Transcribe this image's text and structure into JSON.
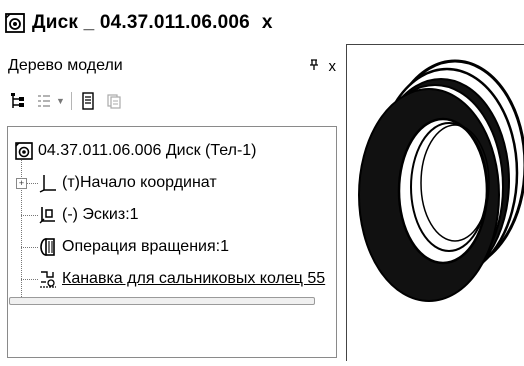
{
  "document_tab": {
    "title": "Диск _ 04.37.011.06.006",
    "close_label": "x"
  },
  "panel": {
    "title": "Дерево модели",
    "pin_label": "ᵃ",
    "close_label": "x"
  },
  "toolbar": {
    "icons": [
      "tree-structure-icon",
      "list-view-icon",
      "dropdown-caret-icon",
      "properties-icon",
      "copy-view-icon"
    ]
  },
  "tree": {
    "items": [
      {
        "label": "04.37.011.06.006 Диск (Тел-1)",
        "icon": "part-icon"
      },
      {
        "label": "(т)Начало координат",
        "icon": "origin-axes-icon",
        "expander": "+"
      },
      {
        "label": "(-) Эскиз:1",
        "icon": "sketch-icon"
      },
      {
        "label": "Операция вращения:1",
        "icon": "revolve-icon"
      },
      {
        "label": "Канавка для сальниковых колец 55",
        "icon": "groove-icon"
      }
    ]
  },
  "colors": {
    "tree_border": "#8a8a8a",
    "viewport_border": "#444444",
    "model_dark": "#111111",
    "model_light": "#ffffff"
  }
}
